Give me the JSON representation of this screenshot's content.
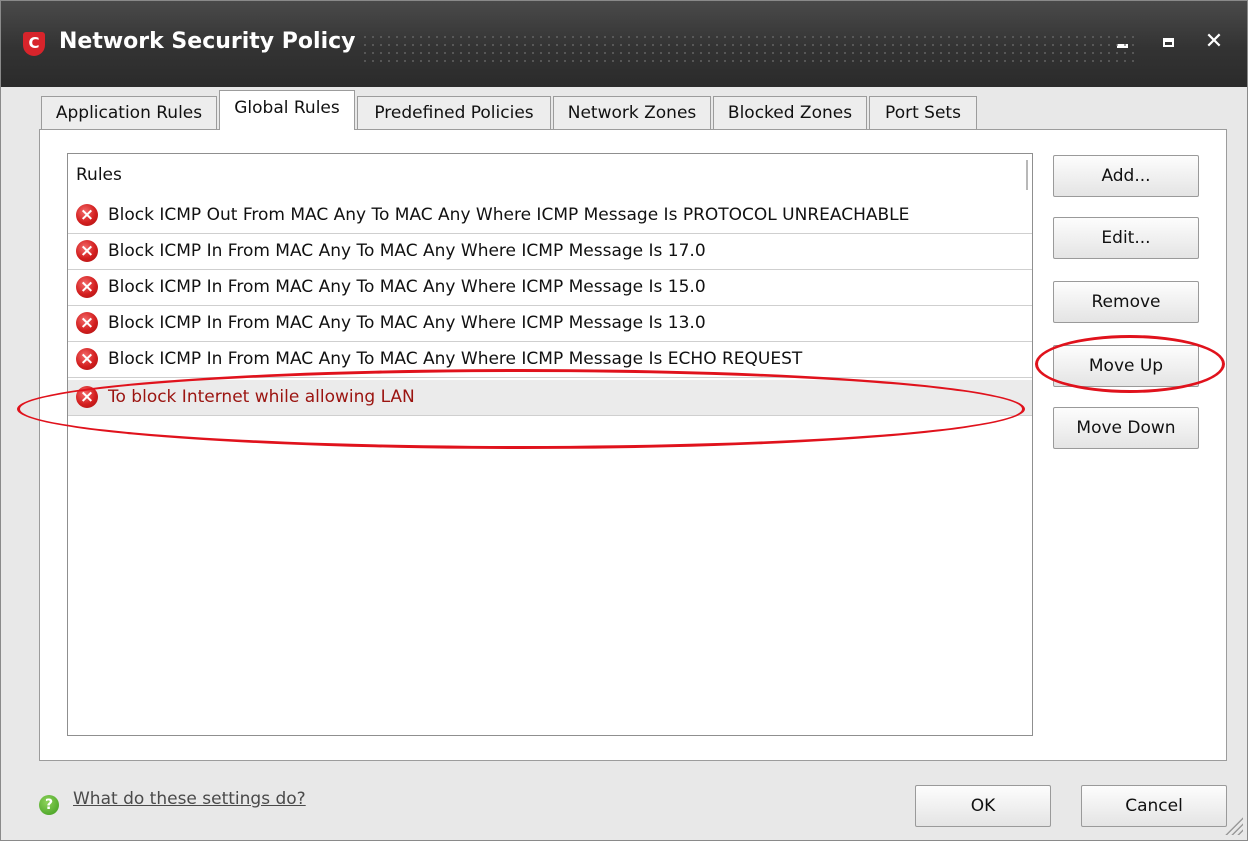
{
  "window": {
    "title": "Network Security Policy",
    "logo_letter": "C",
    "controls": {
      "close_glyph": "✕"
    }
  },
  "tabs": [
    {
      "label": "Application Rules",
      "active": false
    },
    {
      "label": "Global Rules",
      "active": true
    },
    {
      "label": "Predefined Policies",
      "active": false
    },
    {
      "label": "Network Zones",
      "active": false
    },
    {
      "label": "Blocked Zones",
      "active": false
    },
    {
      "label": "Port Sets",
      "active": false
    }
  ],
  "rules_list": {
    "header": "Rules",
    "rows": [
      {
        "icon": "block-error-icon",
        "text": "Block ICMP Out From MAC Any To MAC Any Where ICMP Message Is PROTOCOL UNREACHABLE",
        "selected": false
      },
      {
        "icon": "block-error-icon",
        "text": "Block ICMP In From MAC Any To MAC Any Where ICMP Message Is 17.0",
        "selected": false
      },
      {
        "icon": "block-error-icon",
        "text": "Block ICMP In From MAC Any To MAC Any Where ICMP Message Is 15.0",
        "selected": false
      },
      {
        "icon": "block-error-icon",
        "text": "Block ICMP In From MAC Any To MAC Any Where ICMP Message Is 13.0",
        "selected": false
      },
      {
        "icon": "block-error-icon",
        "text": "Block ICMP In From MAC Any To MAC Any Where ICMP Message Is ECHO REQUEST",
        "selected": false
      },
      {
        "icon": "block-error-icon",
        "text": "To block Internet while allowing LAN",
        "selected": true
      }
    ]
  },
  "side_buttons": {
    "add": "Add...",
    "edit": "Edit...",
    "remove": "Remove",
    "move_up": "Move Up",
    "move_down": "Move Down"
  },
  "footer": {
    "help_link": "What do these settings do?",
    "ok": "OK",
    "cancel": "Cancel"
  },
  "colors": {
    "selected_text": "#9b1410",
    "annotation": "#e0121c",
    "titlebar": "#333333"
  }
}
